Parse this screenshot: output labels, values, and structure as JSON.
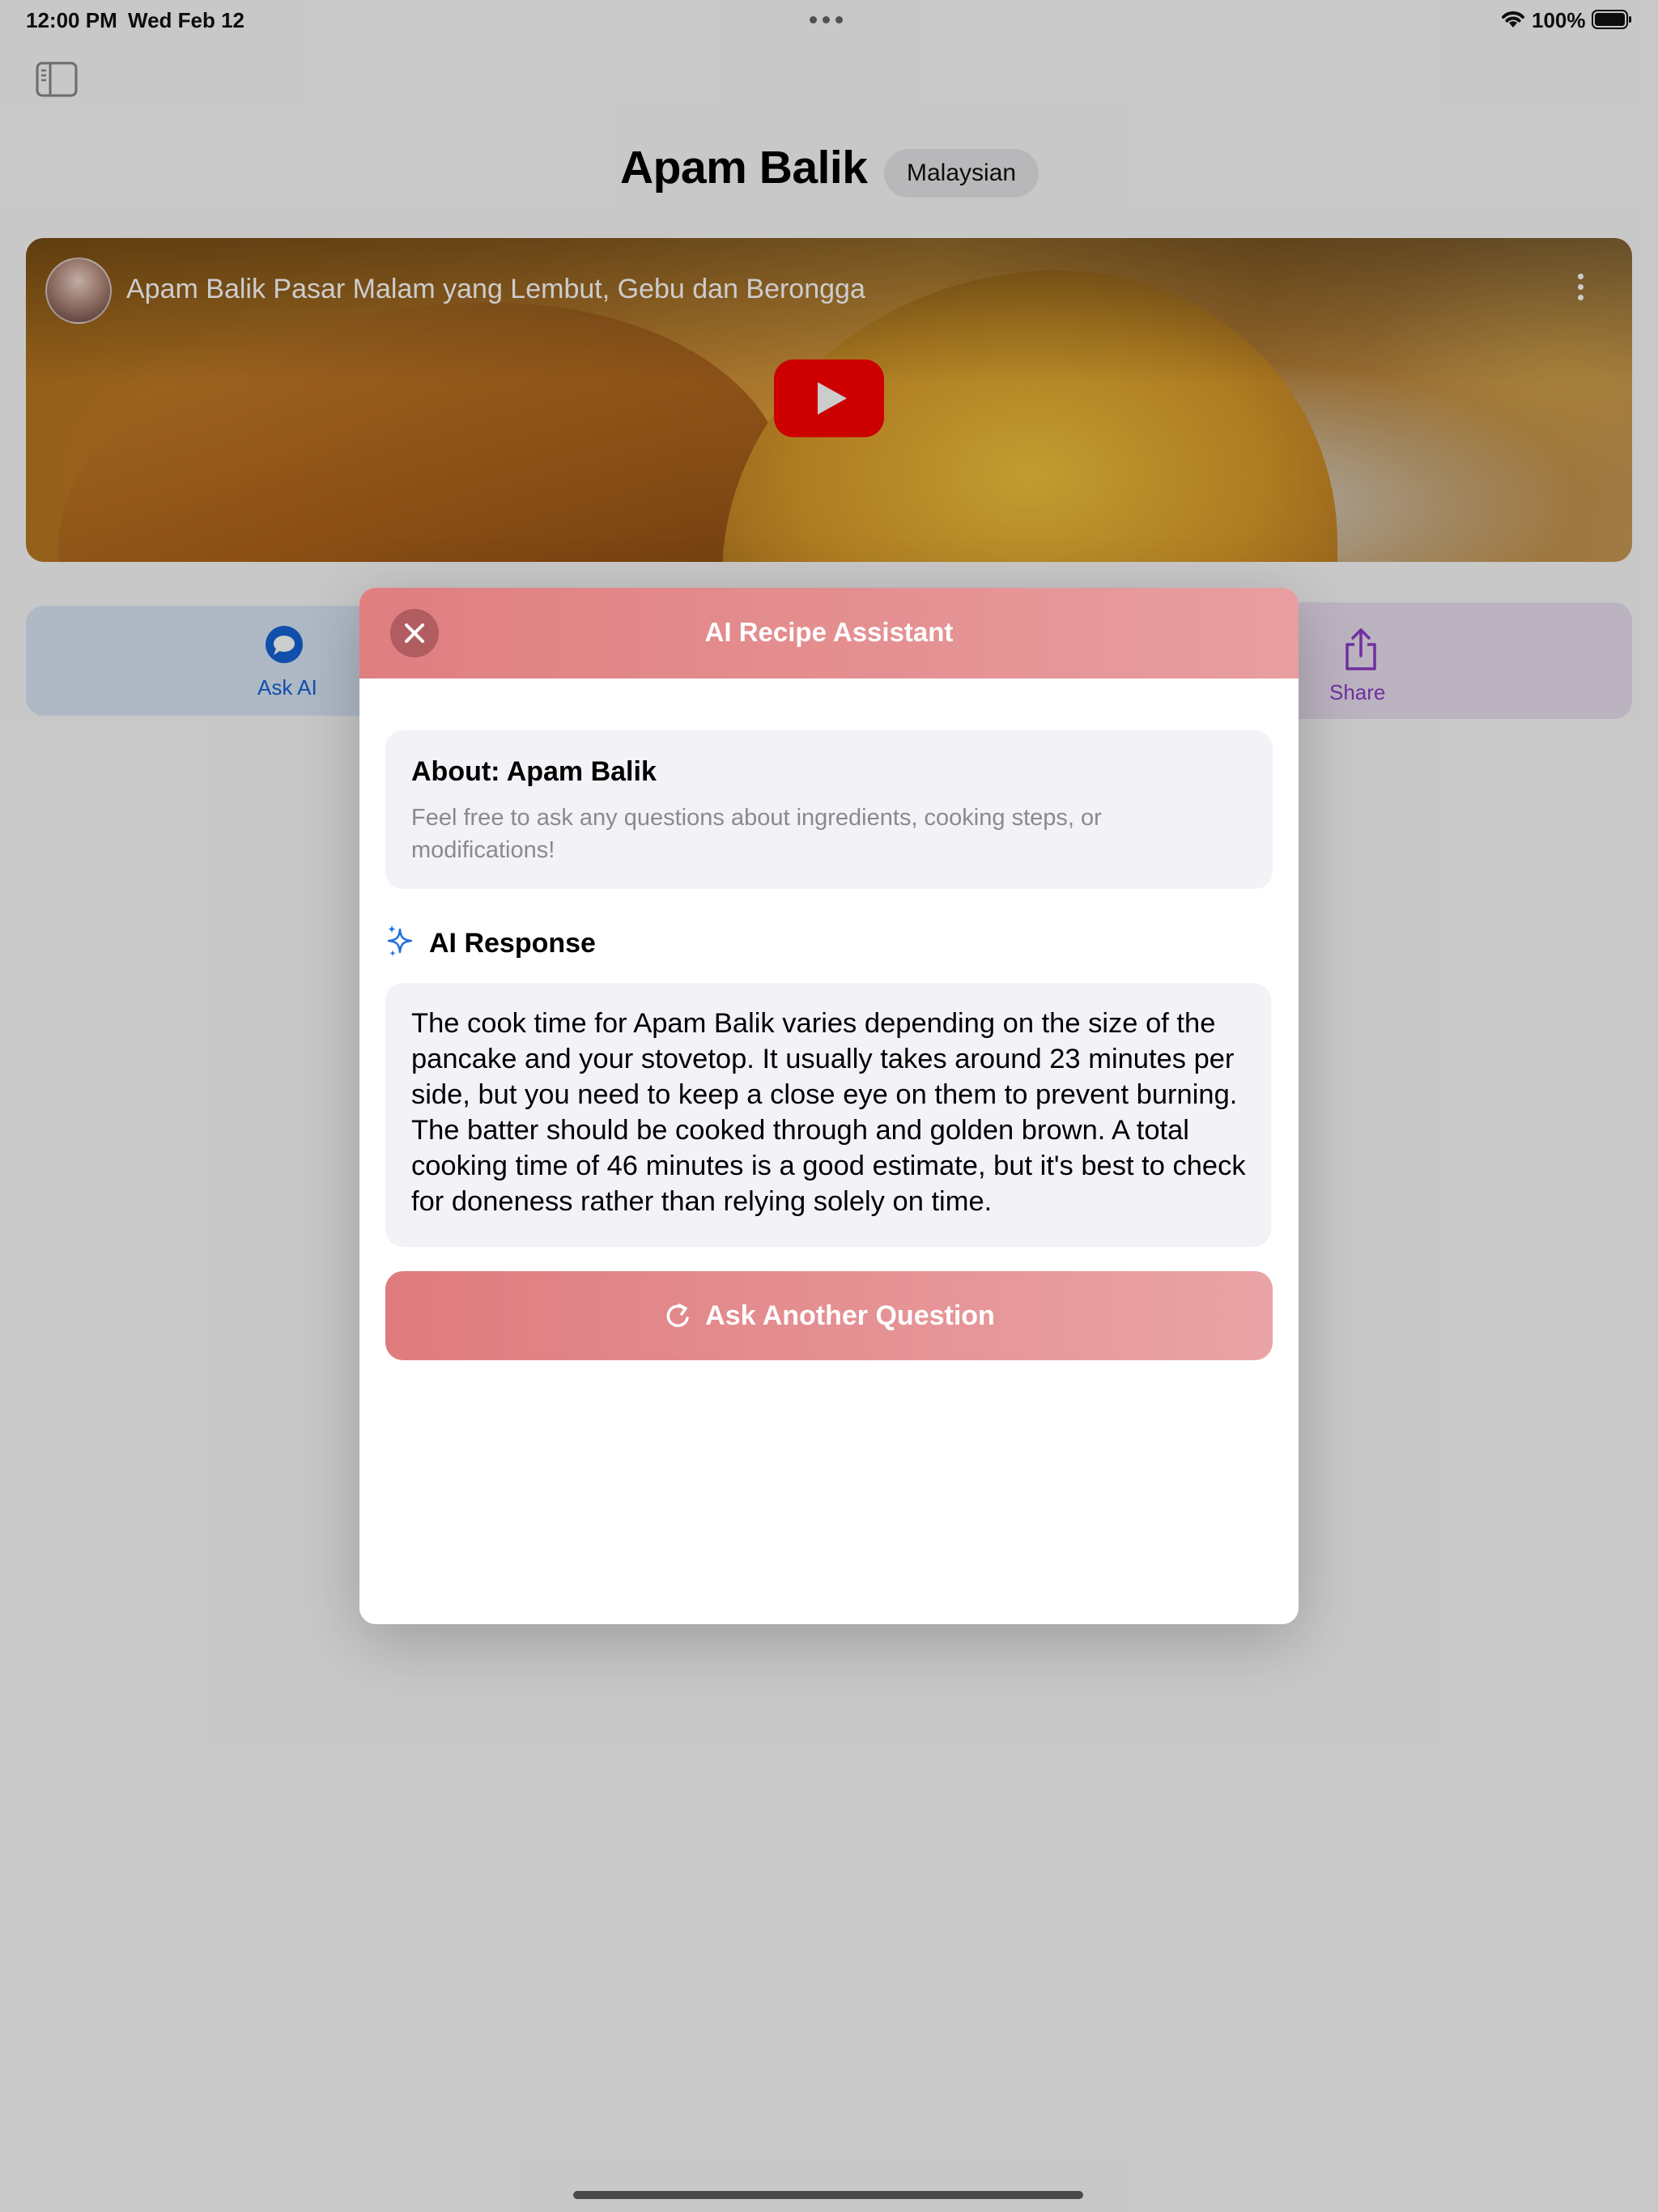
{
  "status_bar": {
    "time": "12:00 PM",
    "date": "Wed Feb 12",
    "battery": "100%",
    "icons": [
      "wifi-icon",
      "battery-icon",
      "multitasking-dots-icon"
    ]
  },
  "page": {
    "title": "Apam Balik",
    "cuisine": "Malaysian",
    "video": {
      "title": "Apam Balik Pasar Malam yang Lembut, Gebu dan Berongga"
    },
    "actions": {
      "ask_ai_label": "Ask AI",
      "share_label": "Share"
    }
  },
  "modal": {
    "title": "AI Recipe Assistant",
    "about": {
      "heading": "About: Apam Balik",
      "text": "Feel free to ask any questions about ingredients, cooking steps, or modifications!"
    },
    "response": {
      "heading": "AI Response",
      "text": "The cook time for Apam Balik varies depending on the size of the pancake and your stovetop.  It usually takes around 23 minutes per side, but you need to keep a close eye on them to prevent burning. The batter should be cooked through and golden brown.  A total cooking time of 46 minutes is a good estimate, but it's best to check for doneness rather than relying solely on time."
    },
    "ask_again_label": "Ask Another Question"
  },
  "colors": {
    "header_gradient_start": "#e07e80",
    "header_gradient_end": "#e89ea0",
    "ask_ai_accent": "#1463d8",
    "share_accent": "#8c3cc8",
    "youtube_red": "#ff0000"
  }
}
